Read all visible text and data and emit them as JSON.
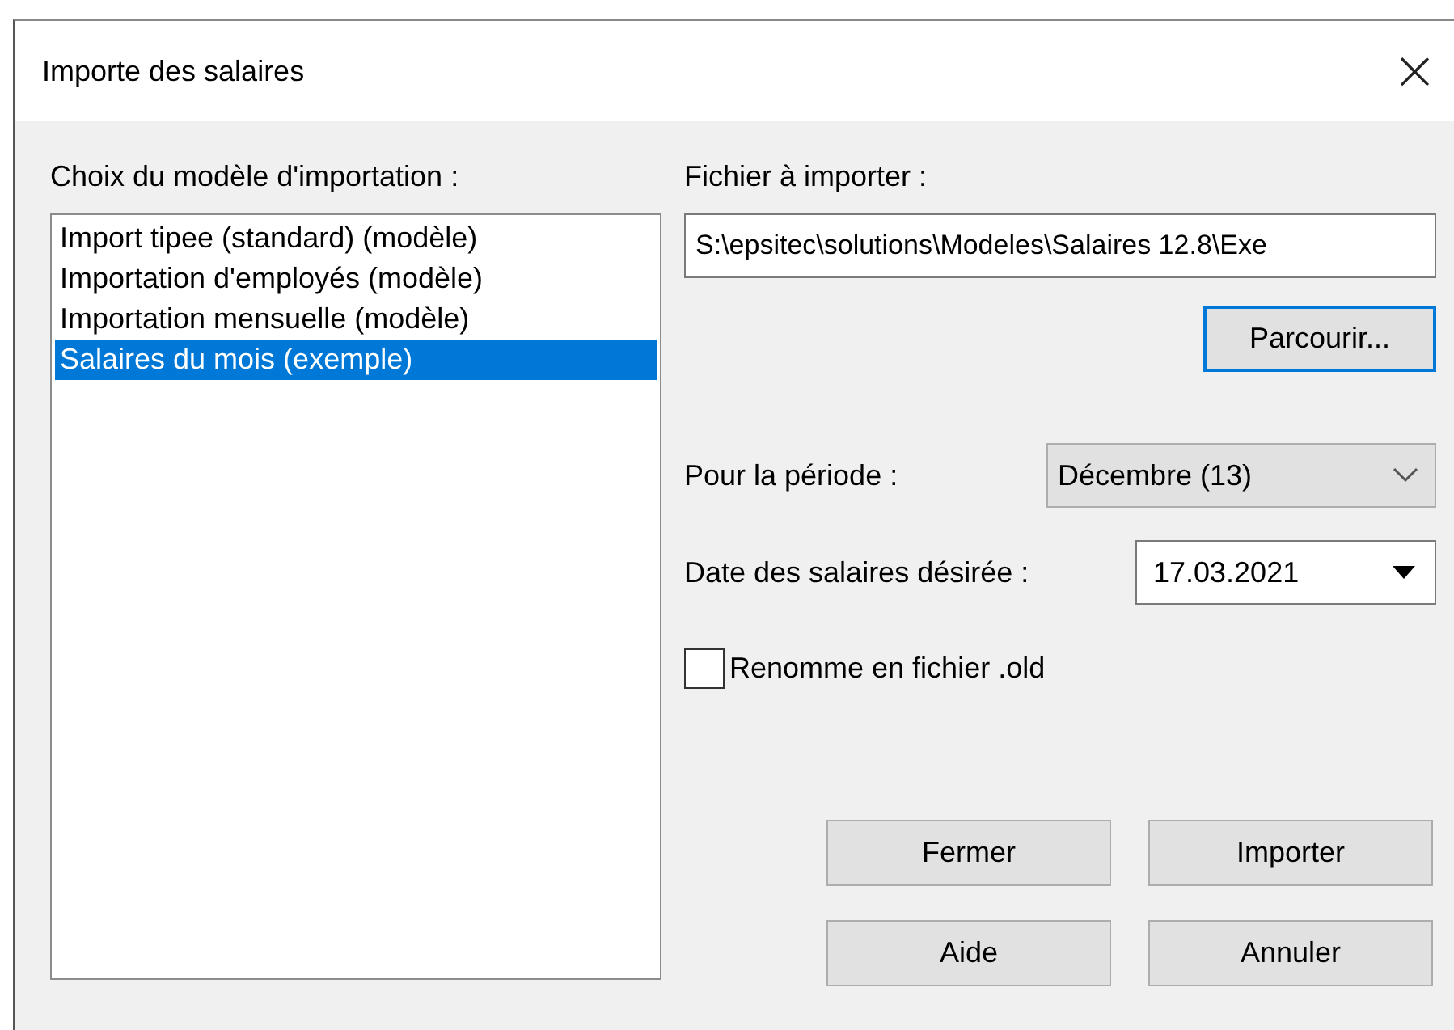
{
  "window": {
    "title": "Importe des salaires",
    "close": "×"
  },
  "models": {
    "label": "Choix du modèle d'importation :",
    "items": [
      {
        "label": "Import tipee (standard) (modèle)",
        "selected": false
      },
      {
        "label": "Importation d'employés (modèle)",
        "selected": false
      },
      {
        "label": "Importation mensuelle (modèle)",
        "selected": false
      },
      {
        "label": "Salaires du mois (exemple)",
        "selected": true
      }
    ]
  },
  "file": {
    "label": "Fichier à importer :",
    "value": "S:\\epsitec\\solutions\\Modeles\\Salaires 12.8\\Exe",
    "browse": "Parcourir..."
  },
  "period": {
    "label": "Pour la période :",
    "value": "Décembre (13)"
  },
  "date": {
    "label": "Date des salaires désirée :",
    "value": "17.03.2021"
  },
  "rename": {
    "label": "Renomme en fichier .old",
    "checked": false
  },
  "buttons": [
    {
      "label": "Fermer"
    },
    {
      "label": "Importer"
    },
    {
      "label": "Aide"
    },
    {
      "label": "Annuler"
    }
  ]
}
